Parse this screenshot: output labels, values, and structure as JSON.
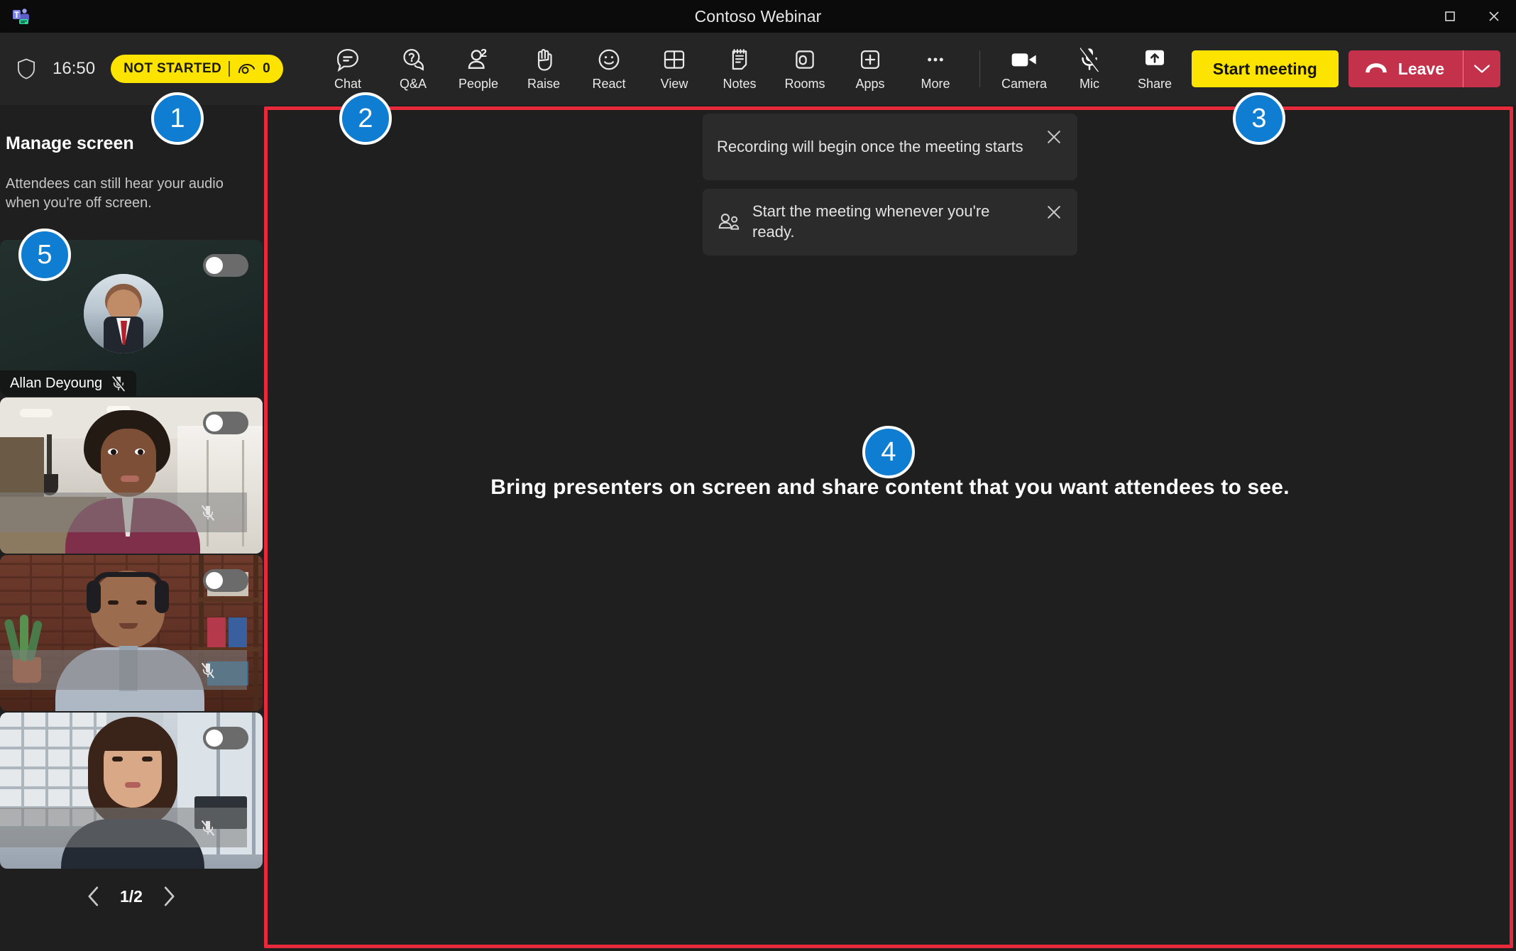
{
  "window": {
    "title": "Contoso Webinar",
    "app_icon": "teams-app-icon",
    "maximize_label": "Maximize",
    "close_label": "Close"
  },
  "command_bar": {
    "shield_icon": "shield-icon",
    "clock": "16:50",
    "status": {
      "label": "NOT STARTED",
      "separator": "|",
      "viewers_icon": "attendee-view-icon",
      "viewers_count": "0",
      "background": "#FDE300",
      "text_color": "#1b1b00"
    },
    "items": [
      {
        "label": "Chat",
        "icon": "chat-icon",
        "badge": ""
      },
      {
        "label": "Q&A",
        "icon": "qa-icon",
        "badge": ""
      },
      {
        "label": "People",
        "icon": "people-icon",
        "badge": "2"
      },
      {
        "label": "Raise",
        "icon": "raise-hand-icon",
        "badge": ""
      },
      {
        "label": "React",
        "icon": "react-smiley-icon",
        "badge": ""
      },
      {
        "label": "View",
        "icon": "view-grid-icon",
        "badge": ""
      },
      {
        "label": "Notes",
        "icon": "notes-icon",
        "badge": ""
      },
      {
        "label": "Rooms",
        "icon": "breakout-rooms-icon",
        "badge": ""
      },
      {
        "label": "Apps",
        "icon": "apps-plus-icon",
        "badge": ""
      },
      {
        "label": "More",
        "icon": "more-ellipsis-icon",
        "badge": ""
      }
    ],
    "device_items": [
      {
        "label": "Camera",
        "icon": "camera-icon"
      },
      {
        "label": "Mic",
        "icon": "mic-muted-icon"
      },
      {
        "label": "Share",
        "icon": "share-screen-icon"
      }
    ],
    "start_meeting_label": "Start meeting",
    "leave_label": "Leave",
    "leave_icon": "hangup-phone-icon",
    "leave_caret_icon": "chevron-down-icon",
    "accent_yellow": "#FDE300",
    "leave_red": "#C4314B"
  },
  "sidebar": {
    "title": "Manage screen",
    "subtitle": "Attendees can still hear your audio when you're off screen.",
    "tiles": [
      {
        "name": "Allan Deyoung",
        "on_screen": false,
        "muted": true,
        "show_name": true,
        "avatar": true
      },
      {
        "name": "",
        "on_screen": false,
        "muted": true,
        "show_name": false,
        "avatar": false
      },
      {
        "name": "",
        "on_screen": false,
        "muted": true,
        "show_name": false,
        "avatar": false
      },
      {
        "name": "",
        "on_screen": false,
        "muted": true,
        "show_name": false,
        "avatar": false
      }
    ],
    "pager": {
      "prev_icon": "chevron-left-icon",
      "text": "1/2",
      "next_icon": "chevron-right-icon"
    }
  },
  "stage": {
    "toasts": [
      {
        "icon": "",
        "text": "Recording will begin once the meeting starts",
        "close_icon": "close-icon"
      },
      {
        "icon": "people-pair-icon",
        "text": "Start the meeting whenever you're ready.",
        "close_icon": "close-icon"
      }
    ],
    "hero_text": "Bring presenters on screen and share content that you want attendees to see."
  },
  "annotations": {
    "highlight_color": "#E8293C",
    "badge_color": "#0F7DD1",
    "badges": [
      {
        "id": "1",
        "target": "manage-screen-panel"
      },
      {
        "id": "2",
        "target": "command-bar-controls"
      },
      {
        "id": "3",
        "target": "start-meeting-button"
      },
      {
        "id": "4",
        "target": "meeting-stage"
      },
      {
        "id": "5",
        "target": "presenter-tile-toggle"
      }
    ]
  }
}
